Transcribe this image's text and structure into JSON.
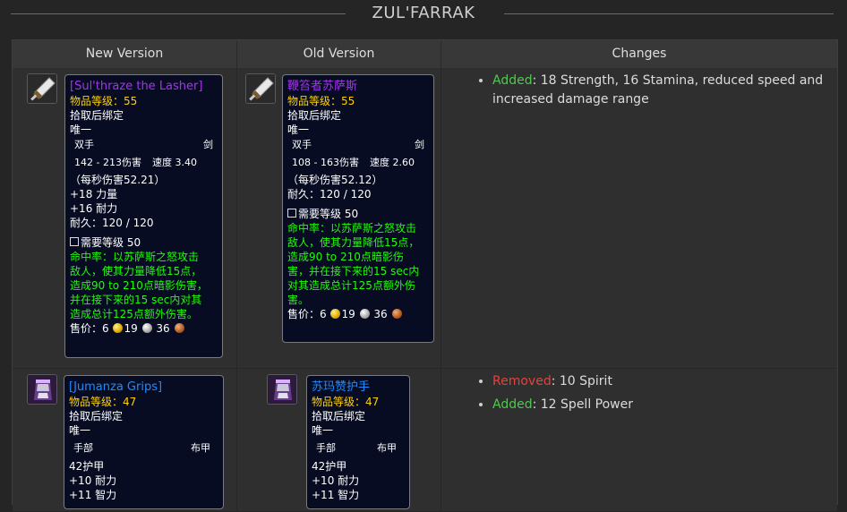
{
  "page": {
    "title": "ZUL'FARRAK"
  },
  "table": {
    "headers": {
      "new_version": "New Version",
      "old_version": "Old Version",
      "changes": "Changes"
    }
  },
  "items": [
    {
      "new": {
        "icon": "sword-icon",
        "name": "[Sul'thraze the Lasher]",
        "item_level": "物品等级：55",
        "bind": "拾取后绑定",
        "unique": "唯一",
        "slot": "双手",
        "type": "剑",
        "damage": "142 - 213伤害",
        "speed": "速度 3.40",
        "dps": "（每秒伤害52.21）",
        "stats": [
          "+18 力量",
          "+16 耐力"
        ],
        "durability": "耐久：120 / 120",
        "requires": "需要等级 50",
        "effect": [
          "命中率：以苏萨斯之怒攻击",
          "敌人，使其力量降低15点，",
          "造成90 to 210点暗影伤害，",
          "并在接下来的15 sec内对其",
          "造成总计125点额外伤害。"
        ],
        "sell_label": "售价：",
        "gold": "6",
        "silver": "19",
        "copper": "36"
      },
      "old": {
        "icon": "sword-icon",
        "name": "鞭笞者苏萨斯",
        "item_level": "物品等级：55",
        "bind": "拾取后绑定",
        "unique": "唯一",
        "slot": "双手",
        "type": "剑",
        "damage": "108 - 163伤害",
        "speed": "速度 2.60",
        "dps": "（每秒伤害52.12）",
        "durability": "耐久：120 / 120",
        "requires": "需要等级 50",
        "effect": [
          "命中率：以苏萨斯之怒攻击",
          "敌人，使其力量降低15点，",
          "造成90 to 210点暗影伤",
          "害，并在接下来的15 sec内",
          "对其造成总计125点额外伤",
          "害。"
        ],
        "sell_label": "售价：",
        "gold": "6",
        "silver": "19",
        "copper": "36"
      },
      "changes": [
        {
          "type": "Added",
          "text": ": 18 Strength, 16 Stamina, reduced speed and increased damage range"
        }
      ]
    },
    {
      "new": {
        "icon": "gloves-icon",
        "name": "[Jumanza Grips]",
        "item_level": "物品等级：47",
        "bind": "拾取后绑定",
        "unique": "唯一",
        "slot": "手部",
        "type": "布甲",
        "armor": "42护甲",
        "stats": [
          "+10 耐力",
          "+11 智力"
        ]
      },
      "old": {
        "icon": "gloves-icon",
        "name": "苏玛赞护手",
        "item_level": "物品等级：47",
        "bind": "拾取后绑定",
        "unique": "唯一",
        "slot": "手部",
        "type": "布甲",
        "armor": "42护甲",
        "stats": [
          "+10 耐力",
          "+11 智力"
        ]
      },
      "changes": [
        {
          "type": "Removed",
          "text": ": 10 Spirit"
        },
        {
          "type": "Added",
          "text": ": 12 Spell Power"
        }
      ]
    }
  ],
  "colors": {
    "epic": "#a335ee",
    "rare": "#1e8cff",
    "item_level": "#ffd100",
    "green_text": "#1eff00",
    "added": "#4ec94e",
    "removed": "#e8413b"
  }
}
